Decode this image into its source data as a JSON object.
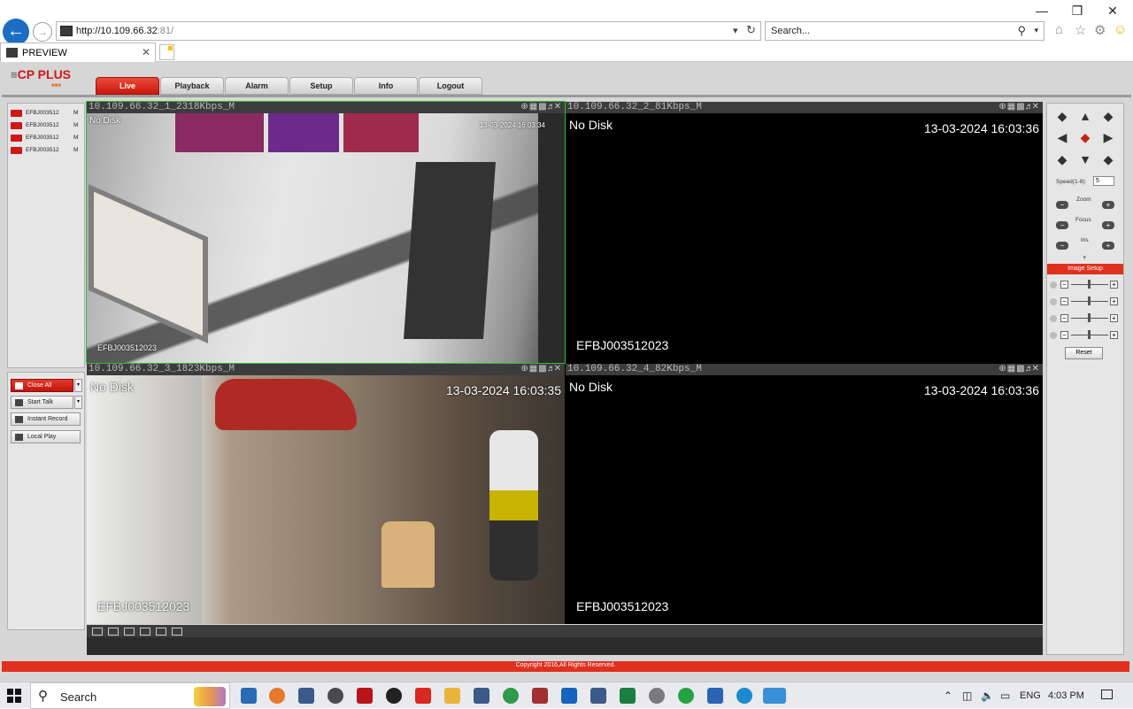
{
  "browser": {
    "address_main": "http://10.109.66.32",
    "address_port": ":81/",
    "search_placeholder": "Search...",
    "tab_title": "PREVIEW"
  },
  "app": {
    "brand": "CP PLUS",
    "nav": [
      "Live",
      "Playback",
      "Alarm",
      "Setup",
      "Info",
      "Logout"
    ],
    "active_nav": "Live",
    "devices": [
      {
        "name": "EFBJ003512",
        "flag": "M"
      },
      {
        "name": "EFBJ003512",
        "flag": "M"
      },
      {
        "name": "EFBJ003512",
        "flag": "M"
      },
      {
        "name": "EFBJ003512",
        "flag": "M"
      }
    ],
    "controls": {
      "close_all": "Close All",
      "start_talk": "Start Talk",
      "instant_record": "Instant Record",
      "local_play": "Local Play"
    },
    "panes": [
      {
        "header": "10.109.66.32_1_2318Kbps_M",
        "no_disk": "No Disk",
        "timestamp": "13-03-2024 16:03:34",
        "channel": "EFBJ003512023"
      },
      {
        "header": "10.109.66.32_2_81Kbps_M",
        "no_disk": "No Disk",
        "timestamp": "13-03-2024 16:03:36",
        "channel": "EFBJ003512023"
      },
      {
        "header": "10.109.66.32_3_1823Kbps_M",
        "no_disk": "No Disk",
        "timestamp": "13-03-2024 16:03:35",
        "channel": "EFBJ003512023"
      },
      {
        "header": "10.109.66.32_4_82Kbps_M",
        "no_disk": "No Disk",
        "timestamp": "13-03-2024 16:03:36",
        "channel": "EFBJ003512023"
      }
    ],
    "ptz": {
      "speed_label": "Speed(1-8):",
      "speed_value": "5",
      "zoom": "Zoom",
      "focus": "Focus",
      "iris": "Iris",
      "image_setup": "Image Setup",
      "reset": "Reset"
    },
    "copyright": "Copyright 2016,All Rights Reserved."
  },
  "taskbar": {
    "search": "Search",
    "language": "ENG",
    "time": "4:03 PM"
  }
}
